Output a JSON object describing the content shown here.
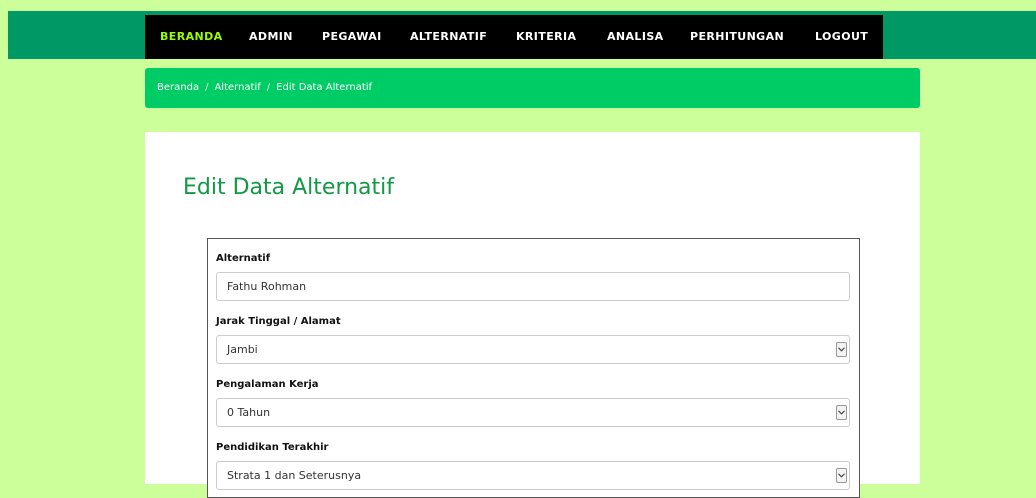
{
  "nav": {
    "items": [
      {
        "label": "BERANDA",
        "active": true
      },
      {
        "label": "ADMIN",
        "active": false
      },
      {
        "label": "PEGAWAI",
        "active": false
      },
      {
        "label": "ALTERNATIF",
        "active": false
      },
      {
        "label": "KRITERIA",
        "active": false
      },
      {
        "label": "ANALISA",
        "active": false
      },
      {
        "label": "PERHITUNGAN",
        "active": false
      },
      {
        "label": "LOGOUT",
        "active": false
      }
    ]
  },
  "breadcrumb": {
    "home": "Beranda",
    "section": "Alternatif",
    "current": "Edit Data Alternatif",
    "separator": "/"
  },
  "page": {
    "title": "Edit Data Alternatif"
  },
  "form": {
    "fields": [
      {
        "label": "Alternatif",
        "value": "Fathu Rohman",
        "type": "text"
      },
      {
        "label": "Jarak Tinggal / Alamat",
        "value": "Jambi",
        "type": "select"
      },
      {
        "label": "Pengalaman Kerja",
        "value": "0 Tahun",
        "type": "select"
      },
      {
        "label": "Pendidikan Terakhir",
        "value": "Strata 1 dan Seterusnya",
        "type": "select"
      }
    ]
  },
  "colors": {
    "page_background": "#ccff99",
    "topbar": "#009966",
    "navbar": "#000000",
    "nav_active": "#99ff00",
    "breadcrumb_bg": "#00cc66",
    "title": "#119944"
  },
  "icons": {
    "select_arrow": "chevron-down-icon"
  }
}
